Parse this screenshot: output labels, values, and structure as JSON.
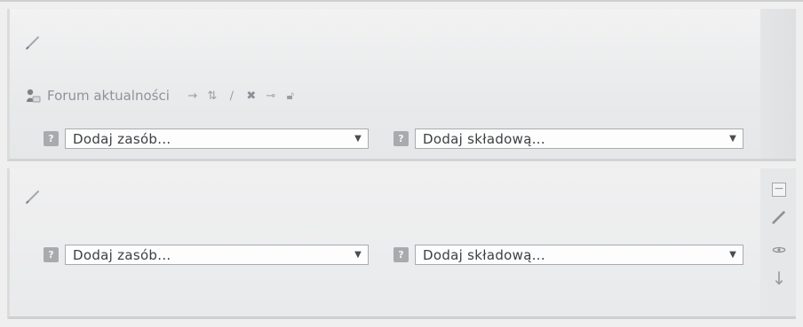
{
  "sections": [
    {
      "forum": {
        "label": "Forum aktualności",
        "actions": [
          "move-right-icon",
          "move-updown-icon",
          "edit-icon",
          "delete-icon",
          "hide-icon",
          "unlock-icon"
        ]
      },
      "resource_select": {
        "value": "Dodaj zasób...",
        "help": "?"
      },
      "component_select": {
        "value": "Dodaj składową...",
        "help": "?"
      }
    },
    {
      "resource_select": {
        "value": "Dodaj zasób...",
        "help": "?"
      },
      "component_select": {
        "value": "Dodaj składową...",
        "help": "?"
      },
      "side_tools": [
        "collapse-icon",
        "edit-icon",
        "hide-icon",
        "move-down-icon"
      ]
    }
  ],
  "colors": {
    "help_icon_bg": "#a8abad",
    "select_border": "#a9abad",
    "muted_text": "#8f9396"
  }
}
